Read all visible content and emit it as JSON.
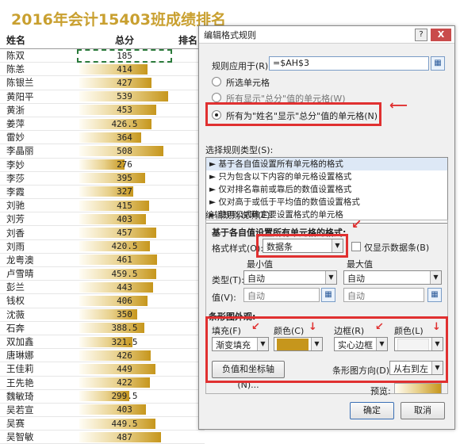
{
  "title": "2016年会计15403班成绩排名",
  "columns": {
    "name": "姓名",
    "score": "总分",
    "rank": "排名"
  },
  "students": [
    {
      "name": "陈双",
      "score": "185",
      "level": 0.0
    },
    {
      "name": "陈恙",
      "score": "414",
      "level": 0.75
    },
    {
      "name": "陈银兰",
      "score": "427",
      "level": 0.8
    },
    {
      "name": "黄阳平",
      "score": "539",
      "level": 0.98
    },
    {
      "name": "黄浙",
      "score": "453",
      "level": 0.85
    },
    {
      "name": "姜萍",
      "score": "426.5",
      "level": 0.8
    },
    {
      "name": "雷妙",
      "score": "364",
      "level": 0.68
    },
    {
      "name": "李晶丽",
      "score": "508",
      "level": 0.93
    },
    {
      "name": "李妙",
      "score": "276",
      "level": 0.5
    },
    {
      "name": "李莎",
      "score": "395",
      "level": 0.73
    },
    {
      "name": "李霞",
      "score": "327",
      "level": 0.6
    },
    {
      "name": "刘驰",
      "score": "415",
      "level": 0.77
    },
    {
      "name": "刘芳",
      "score": "403",
      "level": 0.74
    },
    {
      "name": "刘香",
      "score": "457",
      "level": 0.85
    },
    {
      "name": "刘雨",
      "score": "420.5",
      "level": 0.78
    },
    {
      "name": "龙粤澳",
      "score": "461",
      "level": 0.86
    },
    {
      "name": "卢雪晴",
      "score": "459.5",
      "level": 0.85
    },
    {
      "name": "彭兰",
      "score": "443",
      "level": 0.82
    },
    {
      "name": "钱权",
      "score": "406",
      "level": 0.75
    },
    {
      "name": "沈薇",
      "score": "350",
      "level": 0.64
    },
    {
      "name": "石奔",
      "score": "388.5",
      "level": 0.72
    },
    {
      "name": "双加鑫",
      "score": "321.5",
      "level": 0.59
    },
    {
      "name": "唐琳娜",
      "score": "426",
      "level": 0.79
    },
    {
      "name": "王佳莉",
      "score": "449",
      "level": 0.84
    },
    {
      "name": "王先艳",
      "score": "422",
      "level": 0.78
    },
    {
      "name": "魏敏琦",
      "score": "299.5",
      "level": 0.55
    },
    {
      "name": "吴若宣",
      "score": "403",
      "level": 0.74
    },
    {
      "name": "吴赛",
      "score": "449.5",
      "level": 0.84
    },
    {
      "name": "吴智敏",
      "score": "487",
      "level": 0.9
    }
  ],
  "dialog": {
    "title": "编辑格式规则",
    "help": "?",
    "close": "X",
    "applies_to_label": "规则应用于(R):",
    "applies_to_value": "=$AH$3",
    "radio_selected_cells": "所选单元格",
    "radio_show_cells": "所有显示\"总分\"值的单元格(W)",
    "radio_name_cells": "所有为\"姓名\"显示\"总分\"值的单元格(N)",
    "rule_type_label": "选择规则类型(S):",
    "rule_types": [
      "► 基于各自值设置所有单元格的格式",
      "► 只为包含以下内容的单元格设置格式",
      "► 仅对排名靠前或靠后的数值设置格式",
      "► 仅对高于或低于平均值的数值设置格式",
      "► 使用公式确定要设置格式的单元格"
    ],
    "edit_desc_label": "编辑规则说明(E):",
    "format_all_label": "基于各自值设置所有单元格的格式:",
    "format_style_label": "格式样式(O):",
    "format_style_value": "数据条",
    "show_bar_only": "仅显示数据条(B)",
    "min_label": "最小值",
    "max_label": "最大值",
    "type_label": "类型(T):",
    "type_min": "自动",
    "type_max": "自动",
    "value_label": "值(V):",
    "value_min": "自动",
    "value_max": "自动",
    "bar_appearance_label": "条形图外观:",
    "fill_label": "填充(F)",
    "fill_value": "渐变填充",
    "color_label_1": "颜色(C)",
    "border_label": "边框(R)",
    "border_value": "实心边框",
    "color_label_2": "颜色(L)",
    "negative_axis_button": "负值和坐标轴(N)...",
    "bar_direction_label": "条形图方向(D):",
    "bar_direction_value": "从右到左",
    "preview_label": "预览:",
    "ok": "确定",
    "cancel": "取消",
    "accent_bar_color": "#c6961c",
    "highlight_color": "#e03030"
  }
}
